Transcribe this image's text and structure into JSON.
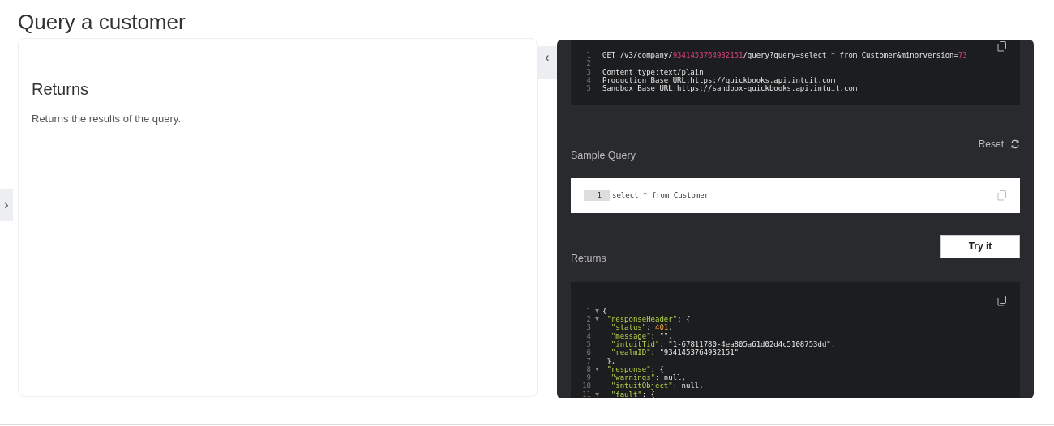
{
  "title": "Query a customer",
  "left_card": {
    "heading": "Returns",
    "description": "Returns the results of the query."
  },
  "collapse_toggle": "‹",
  "expand_toggle": "›",
  "request_block": {
    "lines": [
      {
        "number": "1",
        "segments": [
          {
            "kind": "plain",
            "text": "GET /v3/company/"
          },
          {
            "kind": "highlight",
            "text": "9341453764932151"
          },
          {
            "kind": "plain",
            "text": "/query?query=select * from Customer&minorversion="
          },
          {
            "kind": "highlight",
            "text": "73"
          }
        ]
      },
      {
        "number": "2"
      },
      {
        "number": "3",
        "segments": [
          {
            "kind": "plain",
            "text": "Content type:text/plain"
          }
        ]
      },
      {
        "number": "4",
        "segments": [
          {
            "kind": "plain",
            "text": "Production Base URL:https://quickbooks.api.intuit.com"
          }
        ]
      },
      {
        "number": "5",
        "segments": [
          {
            "kind": "plain",
            "text": "Sandbox Base URL:https://sandbox-quickbooks.api.intuit.com"
          }
        ]
      }
    ]
  },
  "reset_label": "Reset",
  "sample_query": {
    "label": "Sample Query",
    "line_number": "1",
    "value": "select * from Customer"
  },
  "try_button": "Try it",
  "returns_label": "Returns",
  "response_block": {
    "lines": [
      {
        "number": "1",
        "foldable": true,
        "segments": [
          {
            "kind": "plain",
            "text": "{"
          }
        ]
      },
      {
        "number": "2",
        "foldable": true,
        "segments": [
          {
            "kind": "key",
            "text": " \"responseHeader\""
          },
          {
            "kind": "plain",
            "text": ": {"
          }
        ]
      },
      {
        "number": "3",
        "foldable": false,
        "segments": [
          {
            "kind": "key",
            "text": "  \"status\""
          },
          {
            "kind": "plain",
            "text": ": "
          },
          {
            "kind": "number",
            "text": "401"
          },
          {
            "kind": "plain",
            "text": ","
          }
        ]
      },
      {
        "number": "4",
        "foldable": false,
        "segments": [
          {
            "kind": "key",
            "text": "  \"message\""
          },
          {
            "kind": "plain",
            "text": ": "
          },
          {
            "kind": "string",
            "text": "\"\""
          },
          {
            "kind": "plain",
            "text": ","
          }
        ]
      },
      {
        "number": "5",
        "foldable": false,
        "segments": [
          {
            "kind": "key",
            "text": "  \"intuitTid\""
          },
          {
            "kind": "plain",
            "text": ": "
          },
          {
            "kind": "string",
            "text": "\"1-67811780-4ea805a61d02d4c5108753dd\""
          },
          {
            "kind": "plain",
            "text": ","
          }
        ]
      },
      {
        "number": "6",
        "foldable": false,
        "segments": [
          {
            "kind": "key",
            "text": "  \"realmID\""
          },
          {
            "kind": "plain",
            "text": ": "
          },
          {
            "kind": "string",
            "text": "\"9341453764932151\""
          }
        ]
      },
      {
        "number": "7",
        "foldable": false,
        "segments": [
          {
            "kind": "plain",
            "text": " },"
          }
        ]
      },
      {
        "number": "8",
        "foldable": true,
        "segments": [
          {
            "kind": "key",
            "text": " \"response\""
          },
          {
            "kind": "plain",
            "text": ": {"
          }
        ]
      },
      {
        "number": "9",
        "foldable": false,
        "segments": [
          {
            "kind": "key",
            "text": "  \"warnings\""
          },
          {
            "kind": "plain",
            "text": ": null,"
          }
        ]
      },
      {
        "number": "10",
        "foldable": false,
        "segments": [
          {
            "kind": "key",
            "text": "  \"intuitObject\""
          },
          {
            "kind": "plain",
            "text": ": null,"
          }
        ]
      },
      {
        "number": "11",
        "foldable": true,
        "segments": [
          {
            "kind": "key",
            "text": "  \"fault\""
          },
          {
            "kind": "plain",
            "text": ": {"
          }
        ]
      }
    ]
  }
}
